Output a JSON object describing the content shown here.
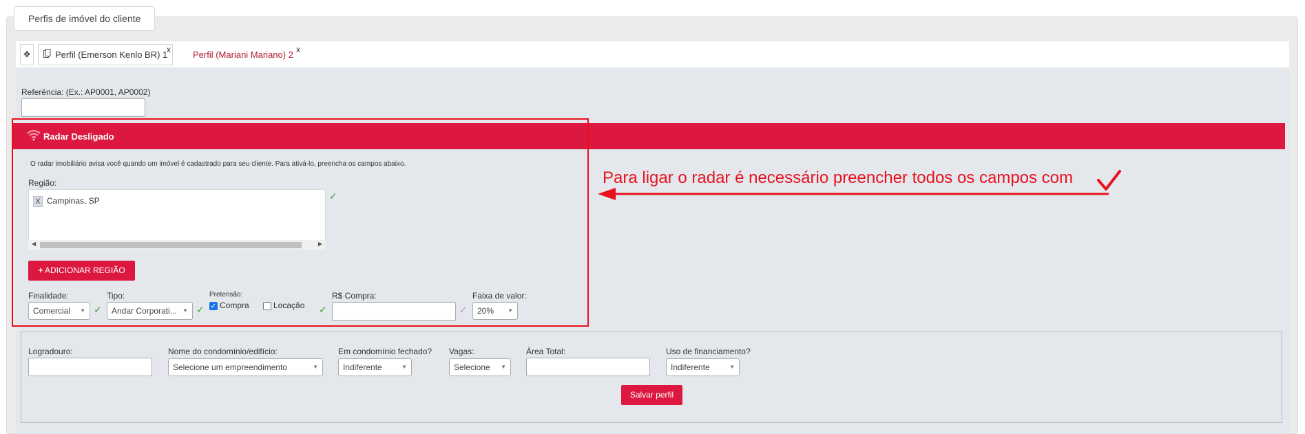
{
  "panel": {
    "title": "Perfis de imóvel do cliente"
  },
  "tabs": {
    "add_symbol": "✥",
    "items": [
      {
        "label": "Perfil (Emerson Kenlo BR) 1",
        "close": "x"
      },
      {
        "label": "Perfil (Mariani Mariano) 2",
        "close": "x"
      }
    ]
  },
  "reference": {
    "label": "Referência: (Ex.: AP0001, AP0002)",
    "value": ""
  },
  "radar": {
    "status": "Radar Desligado",
    "description": "O radar imobiliário avisa você quando um imóvel é cadastrado para seu cliente. Para ativá-lo, preencha os campos abaixo.",
    "region_label": "Região:",
    "regions": [
      {
        "remove": "X",
        "name": "Campinas, SP"
      }
    ],
    "add_region_button": "ADICIONAR REGIÃO",
    "add_icon": "+",
    "finalidade": {
      "label": "Finalidade:",
      "value": "Comercial"
    },
    "tipo": {
      "label": "Tipo:",
      "value": "Andar Corporati..."
    },
    "pretensao": {
      "label": "Pretensão:",
      "options": [
        {
          "label": "Compra",
          "checked": true
        },
        {
          "label": "Locação",
          "checked": false
        }
      ]
    },
    "compra": {
      "label": "R$ Compra:",
      "value": ""
    },
    "faixa": {
      "label": "Faixa de valor:",
      "value": "20%"
    }
  },
  "annotation": {
    "text": "Para ligar o radar é necessário preencher todos os campos com"
  },
  "details": {
    "logradouro": {
      "label": "Logradouro:",
      "value": ""
    },
    "condominio": {
      "label": "Nome do condomínio/edifício:",
      "value": "Selecione um empreendimento"
    },
    "fechado": {
      "label": "Em condomínio fechado?",
      "value": "Indiferente"
    },
    "vagas": {
      "label": "Vagas:",
      "value": "Selecione"
    },
    "area": {
      "label": "Área Total:",
      "value": ""
    },
    "financiamento": {
      "label": "Uso de financiamento?",
      "value": "Indiferente"
    }
  },
  "save_button": "Salvar perfil",
  "colors": {
    "accent": "#dc1840",
    "annotation": "#e8111e",
    "valid": "#3a9b3a"
  }
}
